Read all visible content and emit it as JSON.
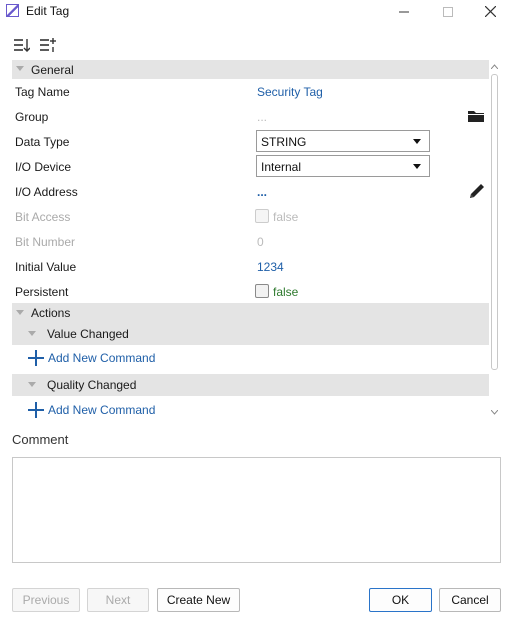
{
  "window": {
    "title": "Edit Tag"
  },
  "sections": {
    "general": "General",
    "actions": "Actions",
    "value_changed": "Value Changed",
    "quality_changed": "Quality Changed"
  },
  "properties": {
    "tag_name": {
      "label": "Tag Name",
      "value": "Security Tag"
    },
    "group": {
      "label": "Group",
      "value": "..."
    },
    "data_type": {
      "label": "Data Type",
      "value": "STRING"
    },
    "io_device": {
      "label": "I/O Device",
      "value": "Internal"
    },
    "io_address": {
      "label": "I/O Address",
      "value": "..."
    },
    "bit_access": {
      "label": "Bit Access",
      "value": "false"
    },
    "bit_number": {
      "label": "Bit Number",
      "value": "0"
    },
    "initial_value": {
      "label": "Initial Value",
      "value": "1234"
    },
    "persistent": {
      "label": "Persistent",
      "value": "false"
    }
  },
  "commands": {
    "add_new_command": "Add New Command"
  },
  "comment": {
    "label": "Comment",
    "value": ""
  },
  "buttons": {
    "previous": "Previous",
    "next": "Next",
    "create_new": "Create New",
    "ok": "OK",
    "cancel": "Cancel"
  },
  "icons": {
    "sort": "sort-icon",
    "categorize": "categorize-icon",
    "folder": "folder-icon",
    "edit": "pencil-icon"
  },
  "colors": {
    "link_blue": "#1f5fa8",
    "false_green": "#2f7a2f",
    "section_bg": "#e4e4e4"
  }
}
